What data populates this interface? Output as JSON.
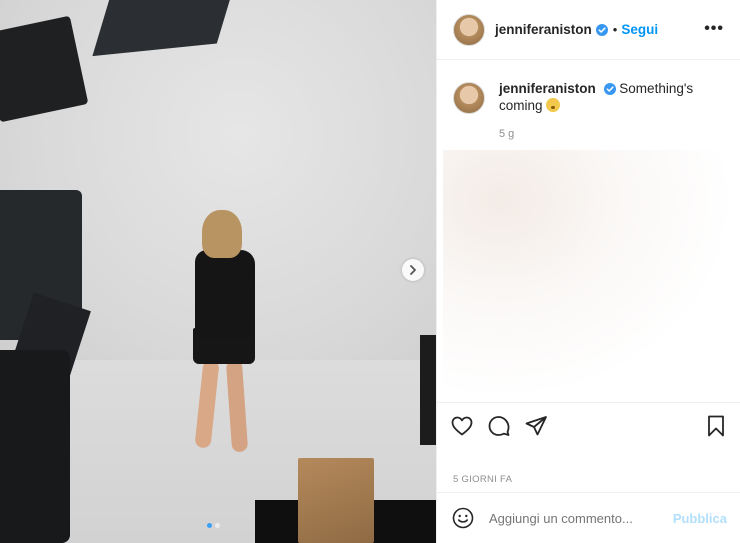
{
  "post": {
    "username": "jenniferaniston",
    "follow_label": "Segui",
    "separator": "•",
    "more_label": "•••"
  },
  "caption": {
    "username": "jenniferaniston",
    "text": "Something's coming",
    "age": "5 g"
  },
  "footer": {
    "date": "5 GIORNI FA",
    "comment_placeholder": "Aggiungi un commento...",
    "publish_label": "Pubblica"
  },
  "carousel": {
    "slide_count": 2,
    "active_index": 0
  },
  "icons": {
    "verified": "verified-badge-icon",
    "like": "heart-icon",
    "comment": "comment-icon",
    "share": "paper-plane-icon",
    "save": "bookmark-icon",
    "emoji": "smiley-icon",
    "next": "chevron-right-icon"
  },
  "colors": {
    "accent": "#0095f6",
    "verified": "#3897f0",
    "publish_disabled": "#b2dffc",
    "muted_text": "#8e8e8e"
  }
}
